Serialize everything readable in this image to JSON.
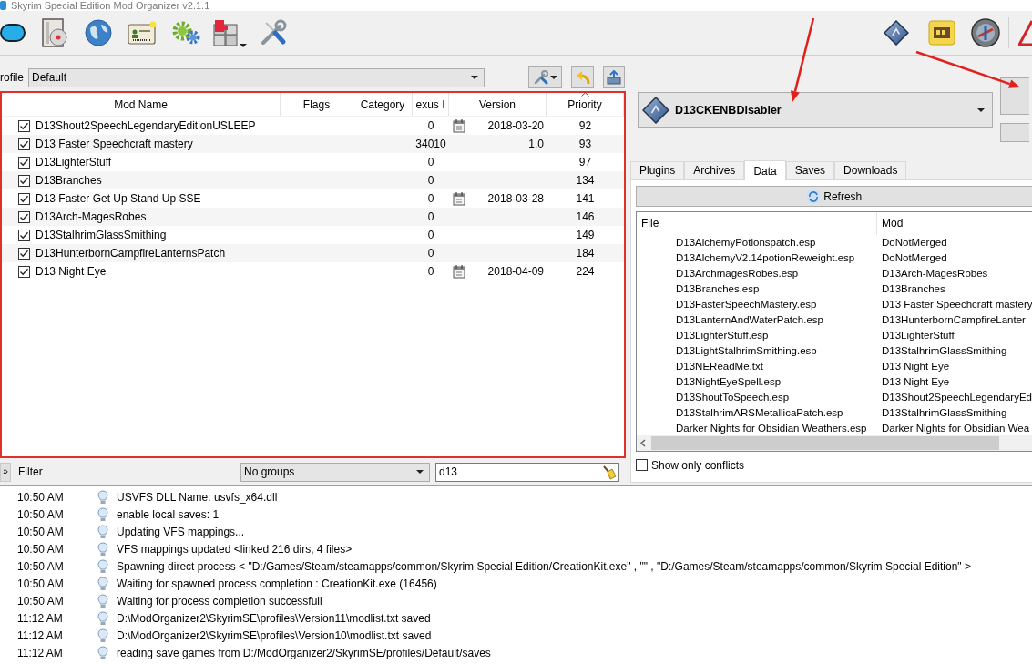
{
  "window": {
    "title": "Skyrim Special Edition Mod Organizer v2.1.1"
  },
  "profile": {
    "label": "rofile",
    "value": "Default"
  },
  "mod_list": {
    "columns": [
      {
        "label": "Mod Name",
        "sorted": false
      },
      {
        "label": "Flags",
        "sorted": false
      },
      {
        "label": "Category",
        "sorted": false
      },
      {
        "label": "exus I",
        "sorted": false
      },
      {
        "label": "Version",
        "sorted": false
      },
      {
        "label": "Priority",
        "sorted": true
      }
    ],
    "rows": [
      {
        "enabled": true,
        "name": "D13Shout2SpeechLegendaryEditionUSLEEP",
        "column_4": "0",
        "date_icon": true,
        "version": "2018-03-20",
        "priority": "92"
      },
      {
        "enabled": true,
        "name": "D13 Faster Speechcraft mastery",
        "column_4": "34010",
        "date_icon": false,
        "version": "1.0",
        "priority": "93"
      },
      {
        "enabled": true,
        "name": "D13LighterStuff",
        "column_4": "0",
        "date_icon": false,
        "priority": "97"
      },
      {
        "enabled": true,
        "name": "D13Branches",
        "column_4": "0",
        "date_icon": false,
        "priority": "134"
      },
      {
        "enabled": true,
        "name": "D13 Faster Get Up Stand Up SSE",
        "column_4": "0",
        "date_icon": true,
        "version": "2018-03-28",
        "priority": "141"
      },
      {
        "enabled": true,
        "name": "D13Arch-MagesRobes",
        "column_4": "0",
        "date_icon": false,
        "priority": "146"
      },
      {
        "enabled": true,
        "name": "D13StalhrimGlassSmithing",
        "column_4": "0",
        "date_icon": false,
        "priority": "149"
      },
      {
        "enabled": true,
        "name": "D13HunterbornCampfireLanternsPatch",
        "column_4": "0",
        "date_icon": false,
        "priority": "184"
      },
      {
        "enabled": true,
        "name": "D13 Night Eye",
        "column_4": "0",
        "date_icon": true,
        "version": "2018-04-09",
        "priority": "224"
      }
    ]
  },
  "filter_bar": {
    "toggle": "»",
    "label": "Filter",
    "groups": "No groups",
    "search": "d13"
  },
  "executable": {
    "name": "D13CKENBDisabler"
  },
  "tabs": [
    {
      "label": "Plugins",
      "selected": false
    },
    {
      "label": "Archives",
      "selected": false
    },
    {
      "label": "Data",
      "selected": true
    },
    {
      "label": "Saves",
      "selected": false
    },
    {
      "label": "Downloads",
      "selected": false
    }
  ],
  "data_tab": {
    "refresh": "Refresh",
    "columns": [
      "File",
      "Mod"
    ],
    "files": [
      {
        "file": "D13AlchemyPotionspatch.esp",
        "mod": "DoNotMerged"
      },
      {
        "file": "D13AlchemyV2.14potionReweight.esp",
        "mod": "DoNotMerged"
      },
      {
        "file": "D13ArchmagesRobes.esp",
        "mod": "D13Arch-MagesRobes"
      },
      {
        "file": "D13Branches.esp",
        "mod": "D13Branches"
      },
      {
        "file": "D13FasterSpeechMastery.esp",
        "mod": "D13 Faster Speechcraft mastery"
      },
      {
        "file": "D13LanternAndWaterPatch.esp",
        "mod": "D13HunterbornCampfireLanter"
      },
      {
        "file": "D13LighterStuff.esp",
        "mod": "D13LighterStuff"
      },
      {
        "file": "D13LightStalhrimSmithing.esp",
        "mod": "D13StalhrimGlassSmithing"
      },
      {
        "file": "D13NEReadMe.txt",
        "mod": "D13 Night Eye"
      },
      {
        "file": "D13NightEyeSpell.esp",
        "mod": "D13 Night Eye"
      },
      {
        "file": "D13ShoutToSpeech.esp",
        "mod": "D13Shout2SpeechLegendaryEd"
      },
      {
        "file": "D13StalhrimARSMetallicaPatch.esp",
        "mod": "D13StalhrimGlassSmithing"
      },
      {
        "file": "Darker Nights for Obsidian Weathers.esp",
        "mod": "Darker Nights for Obsidian Wea"
      }
    ],
    "show_only_conflicts": {
      "label": "Show only conflicts",
      "checked": false
    }
  },
  "log": [
    {
      "time": "10:50 AM",
      "message": "USVFS DLL Name: usvfs_x64.dll"
    },
    {
      "time": "10:50 AM",
      "message": "enable local saves: 1"
    },
    {
      "time": "10:50 AM",
      "message": "Updating VFS mappings..."
    },
    {
      "time": "10:50 AM",
      "message": "VFS mappings updated <linked 216 dirs, 4 files>"
    },
    {
      "time": "10:50 AM",
      "message": "Spawning direct process < \"D:/Games/Steam/steamapps/common/Skyrim Special Edition/CreationKit.exe\" , \"\" , \"D:/Games/Steam/steamapps/common/Skyrim Special Edition\" >"
    },
    {
      "time": "10:50 AM",
      "message": "Waiting for spawned process completion : CreationKit.exe (16456)"
    },
    {
      "time": "10:50 AM",
      "message": "Waiting for process completion successfull"
    },
    {
      "time": "11:12 AM",
      "message": "D:\\ModOrganizer2\\SkyrimSE\\profiles\\Version11\\modlist.txt saved"
    },
    {
      "time": "11:12 AM",
      "message": "D:\\ModOrganizer2\\SkyrimSE\\profiles\\Version10\\modlist.txt saved"
    },
    {
      "time": "11:12 AM",
      "message": "reading save games from D:/ModOrganizer2/SkyrimSE/profiles/Default/saves"
    }
  ]
}
